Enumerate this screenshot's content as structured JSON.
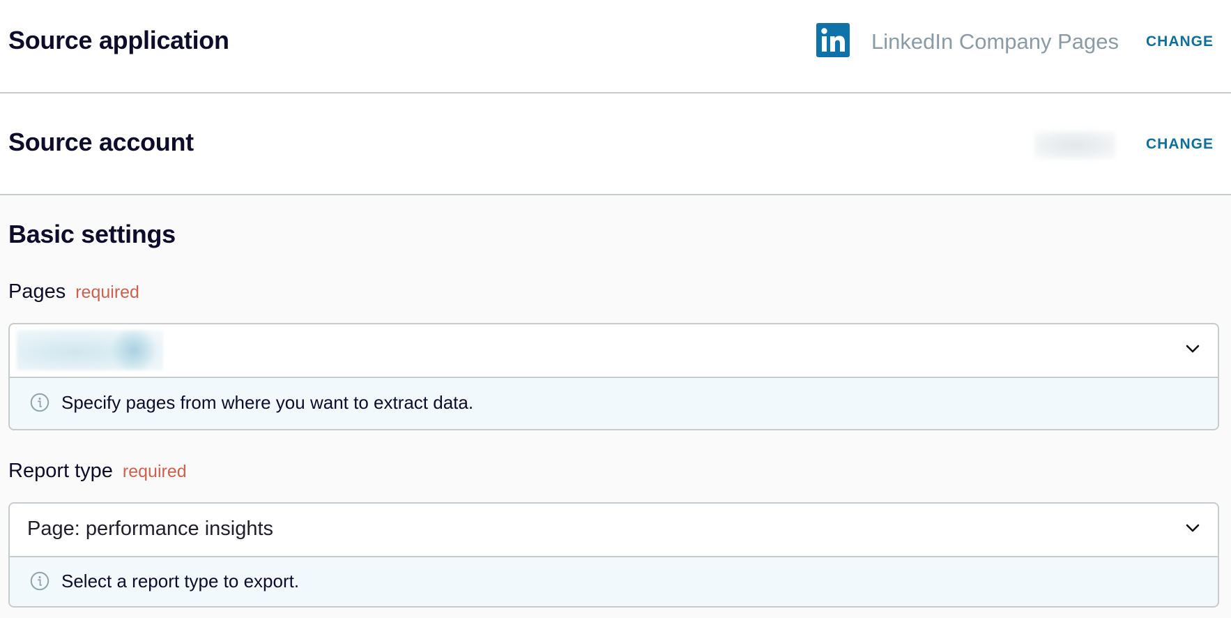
{
  "source_application": {
    "title": "Source application",
    "app_icon": "linkedin-icon",
    "app_name": "LinkedIn Company Pages",
    "change_label": "CHANGE"
  },
  "source_account": {
    "title": "Source account",
    "account_value": "",
    "account_redacted": true,
    "change_label": "CHANGE"
  },
  "basic_settings": {
    "title": "Basic settings",
    "pages": {
      "label": "Pages",
      "required_label": "required",
      "value": "",
      "value_redacted": true,
      "helper_icon": "info-icon",
      "helper_text": "Specify pages from where you want to extract data."
    },
    "report_type": {
      "label": "Report type",
      "required_label": "required",
      "value": "Page: performance insights",
      "helper_icon": "info-icon",
      "helper_text": "Select a report type to export."
    }
  },
  "colors": {
    "accent": "#0e6f9b",
    "required": "#d0604e",
    "linkedin_brand": "#0f73aa",
    "helper_background": "#f2f9fc"
  }
}
